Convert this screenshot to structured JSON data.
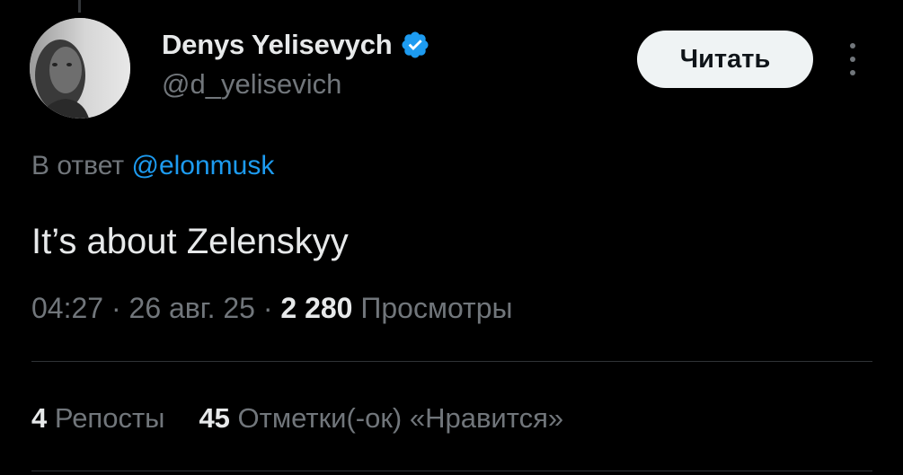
{
  "author": {
    "display_name": "Denys Yelisevych",
    "handle": "@d_yelisevich",
    "verified": true,
    "verified_color": "#1d9bf0",
    "avatar_icon": "avatar-photo"
  },
  "follow_button": {
    "label": "Читать"
  },
  "more_menu": {
    "icon": "more-vertical-icon"
  },
  "reply": {
    "prefix": "В ответ",
    "mention": "@elonmusk"
  },
  "tweet": {
    "text": "It’s about Zelenskyy"
  },
  "meta": {
    "time": "04:27",
    "sep1": "·",
    "date": "26 авг. 25",
    "sep2": "·",
    "views_count": "2 280",
    "views_label": "Просмотры"
  },
  "stats": {
    "reposts_count": "4",
    "reposts_label": "Репосты",
    "likes_count": "45",
    "likes_label": "Отметки(-ок) «Нравится»"
  },
  "colors": {
    "background": "#000000",
    "text_primary": "#e7e9ea",
    "text_secondary": "#71767b",
    "link": "#1d9bf0",
    "button_bg": "#eff3f4"
  }
}
